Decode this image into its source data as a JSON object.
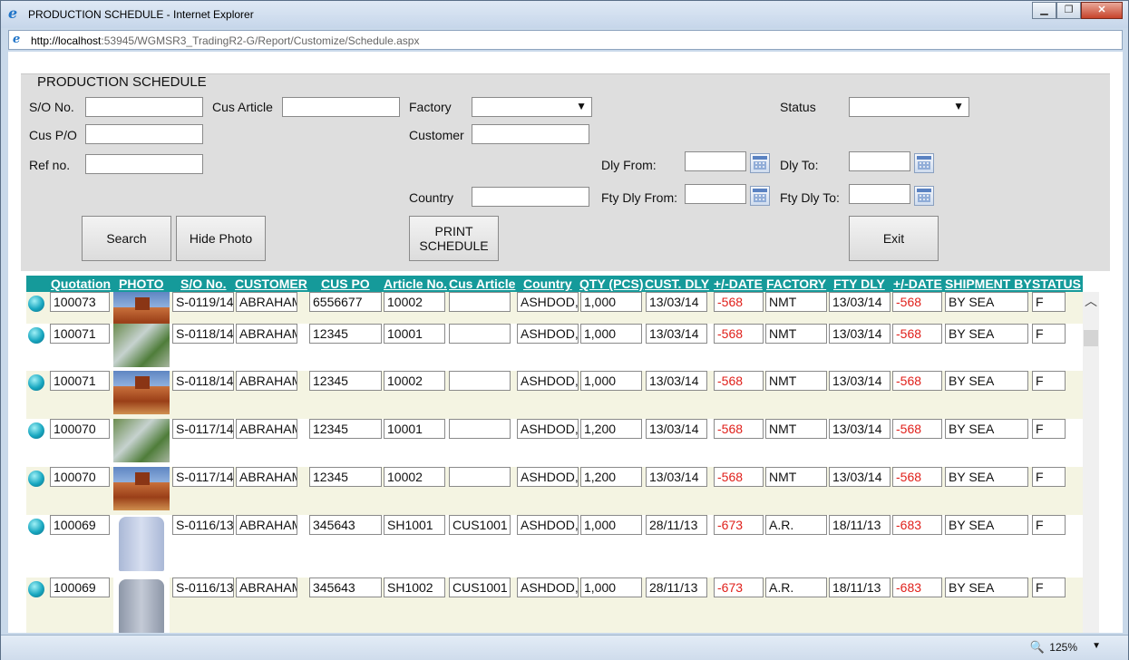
{
  "window": {
    "title": "PRODUCTION SCHEDULE - Internet Explorer",
    "minimize": "▁",
    "restore": "❐",
    "close": "✕"
  },
  "address": {
    "host": "http://localhost",
    "path": ":53945/WGMSR3_TradingR2-G/Report/Customize/Schedule.aspx"
  },
  "form": {
    "legend": "PRODUCTION SCHEDULE",
    "so_label": "S/O No.",
    "so_value": "",
    "cus_article_label": "Cus Article",
    "cus_article_value": "",
    "factory_label": "Factory",
    "factory_value": "",
    "status_label": "Status",
    "status_value": "",
    "cus_po_label": "Cus P/O",
    "cus_po_value": "",
    "customer_label": "Customer",
    "customer_value": "",
    "ref_label": "Ref no.",
    "ref_value": "",
    "dly_from_label": "Dly From:",
    "dly_from_value": "",
    "dly_to_label": "Dly To:",
    "dly_to_value": "",
    "country_label": "Country",
    "country_value": "",
    "fty_dly_from_label": "Fty Dly From:",
    "fty_dly_from_value": "",
    "fty_dly_to_label": "Fty Dly To:",
    "fty_dly_to_value": "",
    "search_btn": "Search",
    "hide_photo_btn": "Hide Photo",
    "print_btn_line1": "PRINT",
    "print_btn_line2": "SCHEDULE",
    "exit_btn": "Exit"
  },
  "grid": {
    "headers": [
      "Quotation",
      "PHOTO",
      "S/O No.",
      "CUSTOMER",
      "CUS PO",
      "Article No.",
      "Cus Article",
      "Country",
      "QTY (PCS)",
      "CUST. DLY",
      "+/-DATE",
      "FACTORY",
      "FTY DLY",
      "+/-DATE",
      "SHIPMENT BY",
      "STATUS"
    ],
    "rows": [
      {
        "quotation": "100073",
        "photo": "rock-photo",
        "so": "S-0119/14",
        "customer": "ABRAHAM",
        "cus_po": "6556677",
        "article": "10002",
        "cus_article": "",
        "country": "ASHDOD,",
        "qty": "1,000",
        "cust_dly": "13/03/14",
        "date_diff1": "-568",
        "factory": "NMT",
        "fty_dly": "13/03/14",
        "date_diff2": "-568",
        "shipment": "BY SEA",
        "status": "F"
      },
      {
        "quotation": "100071",
        "photo": "water-photo",
        "so": "S-0118/14",
        "customer": "ABRAHAM",
        "cus_po": "12345",
        "article": "10001",
        "cus_article": "",
        "country": "ASHDOD,",
        "qty": "1,000",
        "cust_dly": "13/03/14",
        "date_diff1": "-568",
        "factory": "NMT",
        "fty_dly": "13/03/14",
        "date_diff2": "-568",
        "shipment": "BY SEA",
        "status": "F"
      },
      {
        "quotation": "100071",
        "photo": "rock-photo",
        "so": "S-0118/14",
        "customer": "ABRAHAM",
        "cus_po": "12345",
        "article": "10002",
        "cus_article": "",
        "country": "ASHDOD,",
        "qty": "1,000",
        "cust_dly": "13/03/14",
        "date_diff1": "-568",
        "factory": "NMT",
        "fty_dly": "13/03/14",
        "date_diff2": "-568",
        "shipment": "BY SEA",
        "status": "F"
      },
      {
        "quotation": "100070",
        "photo": "water-photo",
        "so": "S-0117/14",
        "customer": "ABRAHAM",
        "cus_po": "12345",
        "article": "10001",
        "cus_article": "",
        "country": "ASHDOD,",
        "qty": "1,200",
        "cust_dly": "13/03/14",
        "date_diff1": "-568",
        "factory": "NMT",
        "fty_dly": "13/03/14",
        "date_diff2": "-568",
        "shipment": "BY SEA",
        "status": "F"
      },
      {
        "quotation": "100070",
        "photo": "rock-photo",
        "so": "S-0117/14",
        "customer": "ABRAHAM",
        "cus_po": "12345",
        "article": "10002",
        "cus_article": "",
        "country": "ASHDOD,",
        "qty": "1,200",
        "cust_dly": "13/03/14",
        "date_diff1": "-568",
        "factory": "NMT",
        "fty_dly": "13/03/14",
        "date_diff2": "-568",
        "shipment": "BY SEA",
        "status": "F"
      },
      {
        "quotation": "100069",
        "photo": "shirt-blue-photo",
        "so": "S-0116/13",
        "customer": "ABRAHAM",
        "cus_po": "345643",
        "article": "SH1001",
        "cus_article": "CUS1001",
        "country": "ASHDOD,",
        "qty": "1,000",
        "cust_dly": "28/11/13",
        "date_diff1": "-673",
        "factory": "A.R.",
        "fty_dly": "18/11/13",
        "date_diff2": "-683",
        "shipment": "BY SEA",
        "status": "F"
      },
      {
        "quotation": "100069",
        "photo": "shirt-grey-photo",
        "so": "S-0116/13",
        "customer": "ABRAHAM",
        "cus_po": "345643",
        "article": "SH1002",
        "cus_article": "CUS1001",
        "country": "ASHDOD,",
        "qty": "1,000",
        "cust_dly": "28/11/13",
        "date_diff1": "-673",
        "factory": "A.R.",
        "fty_dly": "18/11/13",
        "date_diff2": "-683",
        "shipment": "BY SEA",
        "status": "F"
      }
    ]
  },
  "status_bar": {
    "zoom": "125%",
    "zoom_caret": "▼",
    "zoom_icon": "🔍"
  },
  "colors": {
    "grid_header": "#159a9a",
    "negative": "#e0201b",
    "panel": "#dedede"
  }
}
